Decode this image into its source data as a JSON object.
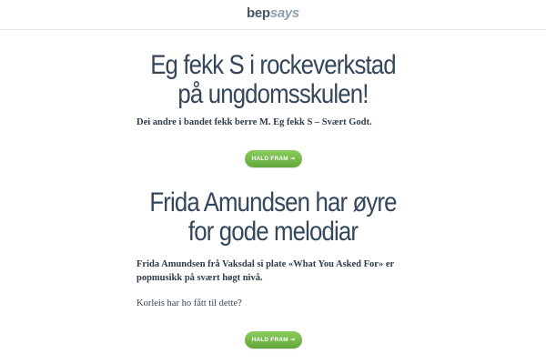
{
  "site": {
    "logo_part1": "bep",
    "logo_part2": "says"
  },
  "articles": [
    {
      "headline_line1": "Eg fekk S i rockeverkstad",
      "headline_line2": "på ungdomsskulen!",
      "lead": "Dei andre i bandet fekk berre M. Eg fekk S – Svært Godt.",
      "button": "HALD FRAM ➞"
    },
    {
      "headline_line1": "Frida Amundsen har øyre",
      "headline_line2": "for gode melodiar",
      "lead": "Frida Amundsen frå Vaksdal si plate «What You Asked For» er popmusikk på svært høgt nivå.",
      "body": "Korleis har ho fått til dette?",
      "button": "HALD FRAM ➞"
    }
  ]
}
